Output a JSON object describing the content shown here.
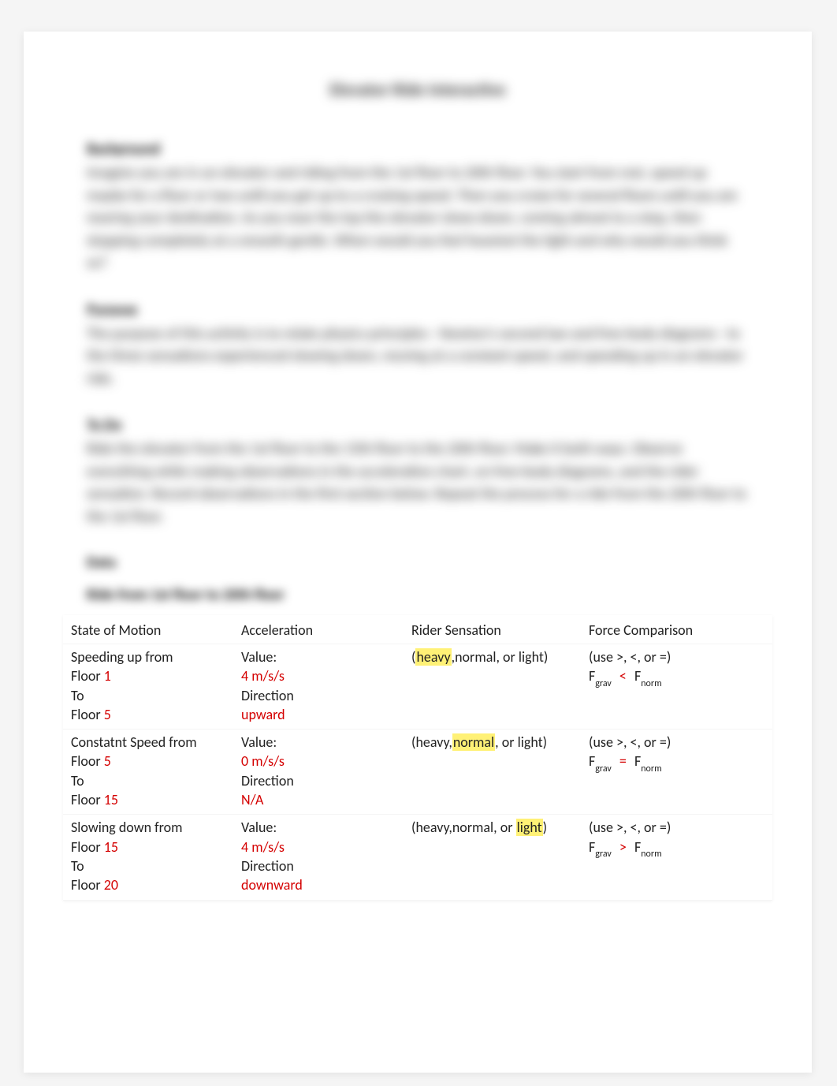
{
  "title": "Elevator Ride Interactive",
  "sections": {
    "s1_h": "Background",
    "s1_b": "Imagine you are in an elevator and riding from the 1st floor to 20th floor. You start from rest, speed up maybe for a floor or two until you get up to a cruising speed. Then you cruise for several floors until you are nearing your destination. As you near the top the elevator slows down, coming almost to a stop, then stopping completely at a smooth gentle. When would you feel heaviest the light and why would you think so?",
    "s2_h": "Purpose",
    "s2_b": "The purpose of this activity is to relate physics principles - Newton's second law and free-body diagrams - to the three sensations experienced slowing down, moving at a constant speed, and speeding up in an elevator ride.",
    "s3_h": "To Do",
    "s3_b": "Ride the elevator from the 1st floor to the 15th floor to the 20th floor. Make it both ways. Observe everything while making observations in the acceleration chart, on free-body diagrams, and the rider sensation. Record observations in the first section below. Repeat the process for a ride from the 20th floor to the 1st floor.",
    "data_label": "Data",
    "ride_label": "Ride from 1st floor to 20th floor"
  },
  "headers": {
    "c1": "State of Motion",
    "c2": "Acceleration",
    "c3": "Rider Sensation",
    "c4": "Force Comparison"
  },
  "labels": {
    "value": "Value:",
    "direction": "Direction",
    "to": "To",
    "floor": "Floor",
    "sens_pre": "(",
    "sens_heavy": "heavy",
    "sens_normal": "normal",
    "sens_light": "light",
    "sens_sep": ",",
    "sens_or": " or ",
    "sens_post": ")",
    "fc_hint": "(use >, <, or =)",
    "Fgrav": "F",
    "grav_sub": "grav",
    "Fnorm": "F",
    "norm_sub": "norm"
  },
  "rows": [
    {
      "motion": "Speeding up from",
      "floor_from": "1",
      "floor_to": "5",
      "acc_value": "4 m/s/s",
      "acc_dir": "upward",
      "sensation_hl": "heavy",
      "cmp": "<"
    },
    {
      "motion": "Constatnt Speed from",
      "floor_from": "5",
      "floor_to": "15",
      "acc_value": "0 m/s/s",
      "acc_dir": "N/A",
      "sensation_hl": "normal",
      "cmp": "="
    },
    {
      "motion": "Slowing down from",
      "floor_from": "15",
      "floor_to": "20",
      "acc_value": "4 m/s/s",
      "acc_dir": "downward",
      "sensation_hl": "light",
      "cmp": ">"
    }
  ]
}
